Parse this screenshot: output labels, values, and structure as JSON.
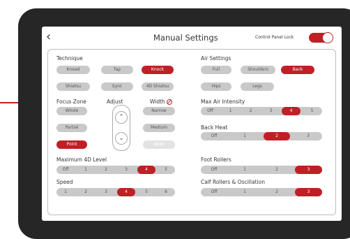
{
  "header": {
    "title": "Manual Settings",
    "lock_label": "Control Panel Lock",
    "back_icon": "chevron-left-icon",
    "lock_on": true
  },
  "technique": {
    "label": "Technique",
    "options": [
      "Knead",
      "Tap",
      "Knock",
      "Shiatsu",
      "Sync",
      "4D Shiatsu"
    ],
    "selected": "Knock"
  },
  "focus": {
    "label": "Focus Zone",
    "options": [
      "Whole",
      "Partial",
      "Point"
    ],
    "selected": "Point"
  },
  "adjust": {
    "label": "Adjust",
    "up_icon": "chevron-up-icon",
    "down_icon": "chevron-down-icon"
  },
  "width": {
    "label": "Width",
    "icon": "no-symbol-icon",
    "options": [
      "Narrow",
      "Medium",
      "Wide"
    ],
    "disabled": "Wide"
  },
  "level4d": {
    "label": "Maximum 4D Level",
    "options": [
      "Off",
      "1",
      "2",
      "3",
      "4",
      "5"
    ],
    "selected": "4"
  },
  "speed": {
    "label": "Speed",
    "options": [
      "1",
      "2",
      "3",
      "4",
      "5",
      "6"
    ],
    "selected": "4"
  },
  "air": {
    "label": "Air Settings",
    "options": [
      "Full",
      "Shoulders",
      "Back",
      "Hips",
      "Legs"
    ],
    "selected": "Back"
  },
  "air_intensity": {
    "label": "Max Air Intensity",
    "options": [
      "Off",
      "1",
      "2",
      "3",
      "4",
      "5"
    ],
    "selected": "4"
  },
  "heat": {
    "label": "Back Heat",
    "options": [
      "Off",
      "1",
      "2",
      "3"
    ],
    "selected": "2"
  },
  "foot": {
    "label": "Foot Rollers",
    "options": [
      "Off",
      "1",
      "2",
      "3"
    ],
    "selected": "3"
  },
  "calf": {
    "label": "Calf Rollers & Oscillation",
    "options": [
      "Off",
      "1",
      "2",
      "3"
    ],
    "selected": "3"
  },
  "colors": {
    "accent": "#bf2026",
    "pill": "#c9c9c9",
    "bezel": "#262626"
  }
}
